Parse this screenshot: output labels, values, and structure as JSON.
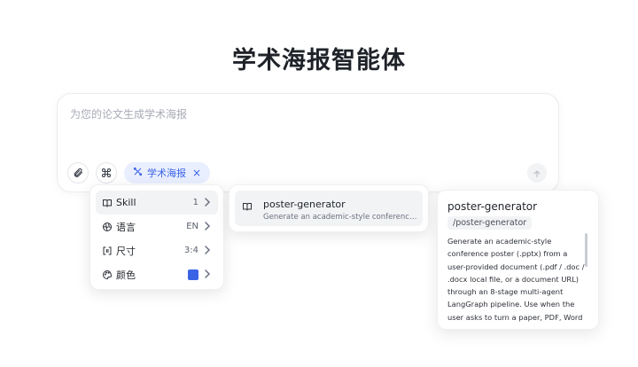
{
  "title": "学术海报智能体",
  "input": {
    "placeholder": "为您的论文生成学术海报",
    "chip_label": "学术海报",
    "chip_close": "×"
  },
  "menu": {
    "items": [
      {
        "label": "Skill",
        "value": "1",
        "icon": "book-icon",
        "active": true
      },
      {
        "label": "语言",
        "value": "EN",
        "icon": "globe-icon"
      },
      {
        "label": "尺寸",
        "value": "3:4",
        "icon": "aspect-ratio-icon"
      },
      {
        "label": "颜色",
        "value": "",
        "icon": "palette-icon",
        "swatch": "#3b63e6"
      }
    ]
  },
  "skill_list": {
    "items": [
      {
        "name": "poster-generator",
        "description": "Generate an academic-style conference poster (.pptx) from a user-provided document"
      }
    ]
  },
  "skill_detail": {
    "name": "poster-generator",
    "slug": "/poster-generator",
    "description": "Generate an academic-style conference poster (.pptx) from a user-provided document (.pdf / .doc / .docx local file, or a document URL) through an 8-stage multi-agent LangGraph pipeline. Use when the user asks to turn a paper, PDF, Word doc, report, or article into a single-"
  },
  "colors": {
    "accent": "#3b63e6",
    "chip_bg": "#e9efff"
  }
}
